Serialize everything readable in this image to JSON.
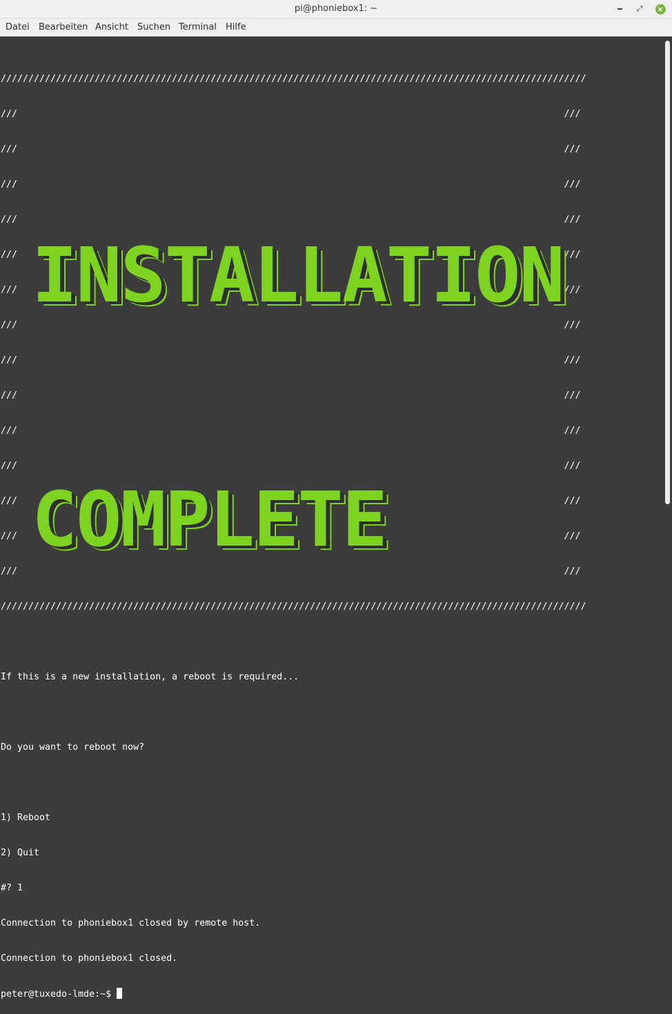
{
  "window": {
    "title": "pi@phoniebox1: ~"
  },
  "menu": {
    "items": [
      "Datei",
      "Bearbeiten",
      "Ansicht",
      "Suchen",
      "Terminal",
      "Hilfe"
    ]
  },
  "terminal": {
    "lines": [
      "//////////////////////////////////////////////////////////////////////////////////////////////////////////",
      "///                                                                                                   ///",
      "///                                                                                                   ///",
      "///                                                                                                   ///",
      "///                                                                                                   ///",
      "///                                                                                                   ///",
      "///                                                                                                   ///",
      "///                                                                                                   ///",
      "///                                                                                                   ///",
      "///                                                                                                   ///",
      "///                                                                                                   ///",
      "///                                                                                                   ///",
      "///                                                                                                   ///",
      "///                                                                                                   ///",
      "///                                                                                                   ///",
      "//////////////////////////////////////////////////////////////////////////////////////////////////////////",
      "",
      "If this is a new installation, a reboot is required...",
      "",
      "Do you want to reboot now?",
      "",
      "1) Reboot",
      "2) Quit",
      "#? 1",
      "Connection to phoniebox1 closed by remote host.",
      "Connection to phoniebox1 closed."
    ],
    "prompt": "peter@tuxedo-lmde:~$ ",
    "banner": [
      "INSTALLATION",
      "COMPLETE"
    ]
  },
  "colors": {
    "terminal_bg": "#3c3c3c",
    "banner": "#7ed321",
    "close_button": "#7cb342"
  }
}
